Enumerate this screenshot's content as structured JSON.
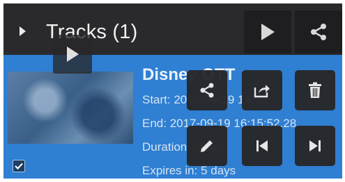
{
  "header": {
    "title": "Tracks (1)",
    "icons": {
      "expand": "caret-right-icon",
      "play": "play-icon",
      "share": "share-icon"
    }
  },
  "track": {
    "name": "Disney OTT",
    "start": "Start: 2017-09-19 16:15",
    "end": "End: 2017-09-19 16:15:52.28",
    "duration": "Duration: 00:00",
    "expires": "Expires in: 5 days",
    "selected": true,
    "actions": [
      "share-icon",
      "export-icon",
      "delete-icon",
      "edit-icon",
      "skip-to-start-icon",
      "skip-to-end-icon"
    ]
  },
  "colors": {
    "header_bg": "#2a2a2c",
    "track_bg": "#2f7fd2",
    "button_bg": "#262628",
    "icon": "#ececec"
  }
}
